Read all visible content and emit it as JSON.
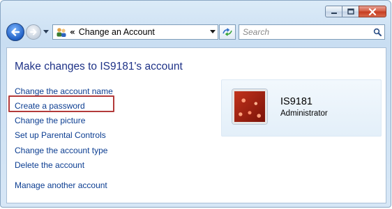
{
  "window": {
    "buttons": {
      "minimize": "minimize-icon",
      "maximize": "maximize-icon",
      "close": "close-icon"
    }
  },
  "navbar": {
    "breadcrumb_prefix": "«",
    "address": "Change an Account",
    "search_placeholder": "Search"
  },
  "main": {
    "title": "Make changes to IS9181's account",
    "links": [
      "Change the account name",
      "Create a password",
      "Change the picture",
      "Set up Parental Controls",
      "Change the account type",
      "Delete the account",
      "Manage another account"
    ],
    "highlighted_link_index": 1,
    "highlight_color": "#b33a3a"
  },
  "account": {
    "name": "IS9181",
    "role": "Administrator"
  },
  "colors": {
    "title": "#1e3287",
    "link": "#0b3d91",
    "card_bg": "#e8f2fb"
  }
}
